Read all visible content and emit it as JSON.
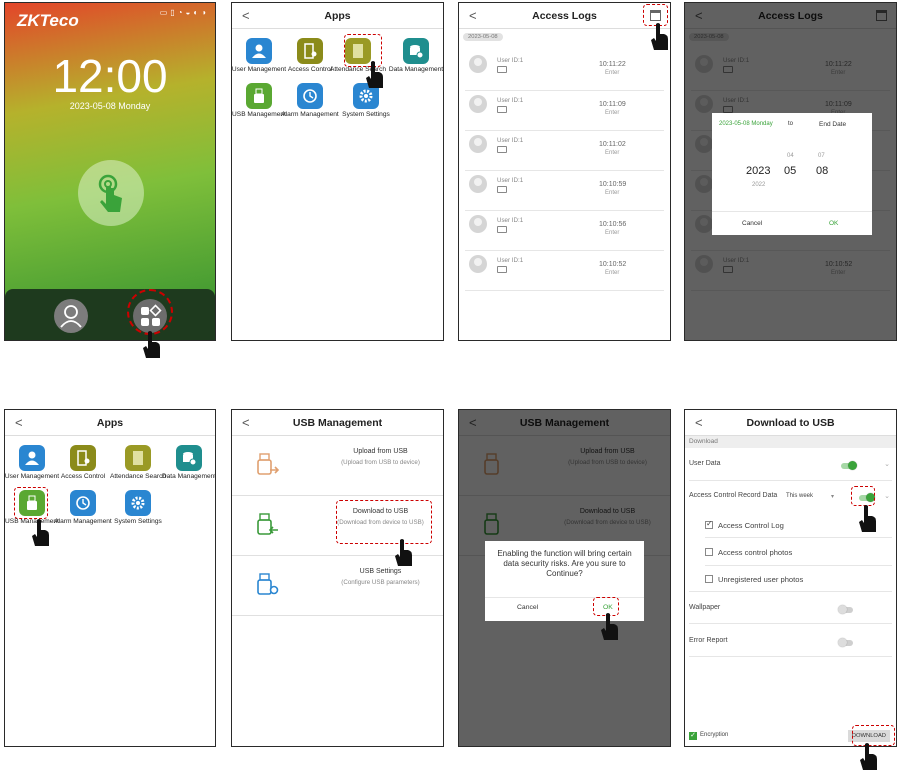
{
  "colors": {
    "accent": "#4caf50",
    "highlight": "#cc0000",
    "calendar_date": "#3aa33a"
  },
  "panel1": {
    "logo": "ZKTeco",
    "time": "12:00",
    "date": "2023-05-08  Monday",
    "icons": [
      "fingerprint-icon",
      "user-icon",
      "apps-icon"
    ]
  },
  "apps": {
    "title": "Apps",
    "back": "<",
    "items": [
      {
        "label": "User Management",
        "icon": "user-management-icon",
        "color": "#2a86d1"
      },
      {
        "label": "Access Control",
        "icon": "access-control-icon",
        "color": "#8b8b1a"
      },
      {
        "label": "Attendance Search",
        "icon": "attendance-search-icon",
        "color": "#9a9a25"
      },
      {
        "label": "Data Management",
        "icon": "data-management-icon",
        "color": "#1f8e8e"
      },
      {
        "label": "USB Management",
        "icon": "usb-management-icon",
        "color": "#5aa832"
      },
      {
        "label": "Alarm Management",
        "icon": "alarm-management-icon",
        "color": "#2a86d1"
      },
      {
        "label": "System Settings",
        "icon": "system-settings-icon",
        "color": "#2a86d1"
      }
    ]
  },
  "logs": {
    "title": "Access Logs",
    "back": "<",
    "date_chip": "2023-05-08",
    "rows": [
      {
        "user": "User ID:1",
        "time": "10:11:22",
        "state": "Enter"
      },
      {
        "user": "User ID:1",
        "time": "10:11:09",
        "state": "Enter"
      },
      {
        "user": "User ID:1",
        "time": "10:11:02",
        "state": "Enter"
      },
      {
        "user": "User ID:1",
        "time": "10:10:59",
        "state": "Enter"
      },
      {
        "user": "User ID:1",
        "time": "10:10:56",
        "state": "Enter"
      },
      {
        "user": "User ID:1",
        "time": "10:10:52",
        "state": "Enter"
      }
    ]
  },
  "date_dialog": {
    "start": "2023-05-08 Monday",
    "to": "to",
    "end": "End Date",
    "year": "2023",
    "year_prev": "2022",
    "month": "05",
    "month_prev": "04",
    "day": "08",
    "day_prev": "07",
    "cancel": "Cancel",
    "ok": "OK"
  },
  "usb": {
    "title": "USB Management",
    "back": "<",
    "items": [
      {
        "title": "Upload from USB",
        "sub": "(Upload from USB to device)",
        "icon": "usb-upload-icon"
      },
      {
        "title": "Download to USB",
        "sub": "(Download from device to USB)",
        "icon": "usb-download-icon"
      },
      {
        "title": "USB Settings",
        "sub": "(Configure USB parameters)",
        "icon": "usb-settings-icon"
      }
    ]
  },
  "confirm": {
    "message": "Enabling the function will bring certain data security risks. Are you sure to Continue?",
    "cancel": "Cancel",
    "ok": "OK"
  },
  "download": {
    "title": "Download to USB",
    "back": "<",
    "section": "Download",
    "user_data": "User Data",
    "acr": "Access Control Record Data",
    "week": "This week",
    "log": "Access Control Log",
    "photos": "Access control photos",
    "unreg": "Unregistered user photos",
    "wallpaper": "Wallpaper",
    "error": "Error Report",
    "encryption": "Encryption",
    "button": "DOWNLOAD"
  }
}
